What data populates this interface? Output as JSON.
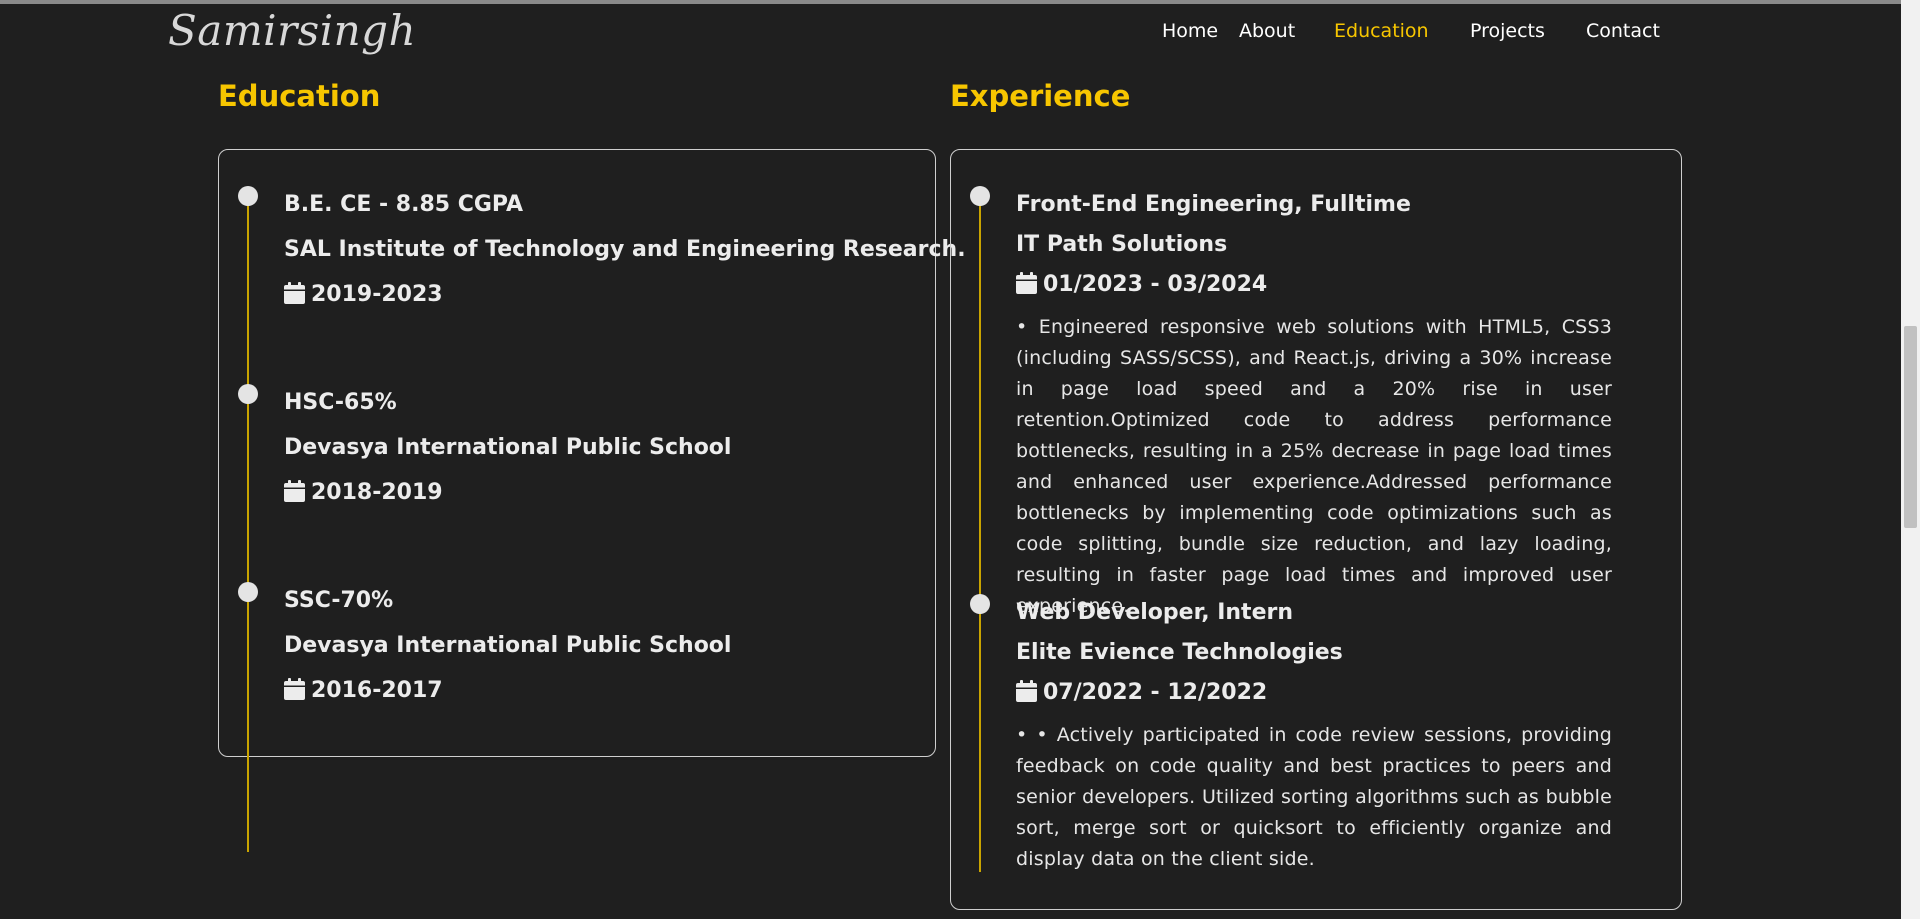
{
  "brand": {
    "logo_text": "Samirsingh"
  },
  "nav": {
    "items": [
      {
        "label": "Home",
        "active": false
      },
      {
        "label": "About",
        "active": false
      },
      {
        "label": "Education",
        "active": true
      },
      {
        "label": "Projects",
        "active": false
      },
      {
        "label": "Contact",
        "active": false
      }
    ]
  },
  "colors": {
    "accent": "#f7c600",
    "background": "#1f1f1f",
    "text": "#e8e8e8"
  },
  "education": {
    "title": "Education",
    "entries": [
      {
        "degree": "B.E. CE - 8.85 CGPA",
        "institution": "SAL Institute of Technology and Engineering Research.",
        "years": "2019-2023",
        "icon": "calendar-icon"
      },
      {
        "degree": "HSC-65%",
        "institution": "Devasya International Public School",
        "years": "2018-2019",
        "icon": "calendar-icon"
      },
      {
        "degree": "SSC-70%",
        "institution": "Devasya International Public School",
        "years": "2016-2017",
        "icon": "calendar-icon"
      }
    ]
  },
  "experience": {
    "title": "Experience",
    "entries": [
      {
        "role": "Front-End Engineering, Fulltime",
        "company": "IT Path Solutions",
        "dates": "01/2023 - 03/2024",
        "icon": "calendar-icon",
        "description": "•  Engineered responsive web solutions with HTML5, CSS3 (including SASS/SCSS), and React.js, driving a 30% increase in page load speed and a 20% rise in user retention.Optimized code to address performance bottlenecks, resulting in a 25% decrease in page load times and enhanced user experience.Addressed performance bottlenecks by implementing code optimizations such as code splitting, bundle size reduction, and lazy loading, resulting in faster page load times and improved user experience."
      },
      {
        "role": "Web Developer, Intern",
        "company": "Elite Evience Technologies",
        "dates": "07/2022 - 12/2022",
        "icon": "calendar-icon",
        "description": "•  • Actively participated in code review sessions, providing feedback on code quality and best practices to peers and senior developers. Utilized sorting algorithms such as bubble sort, merge sort or quicksort to efficiently organize and display data on the client side."
      }
    ]
  }
}
